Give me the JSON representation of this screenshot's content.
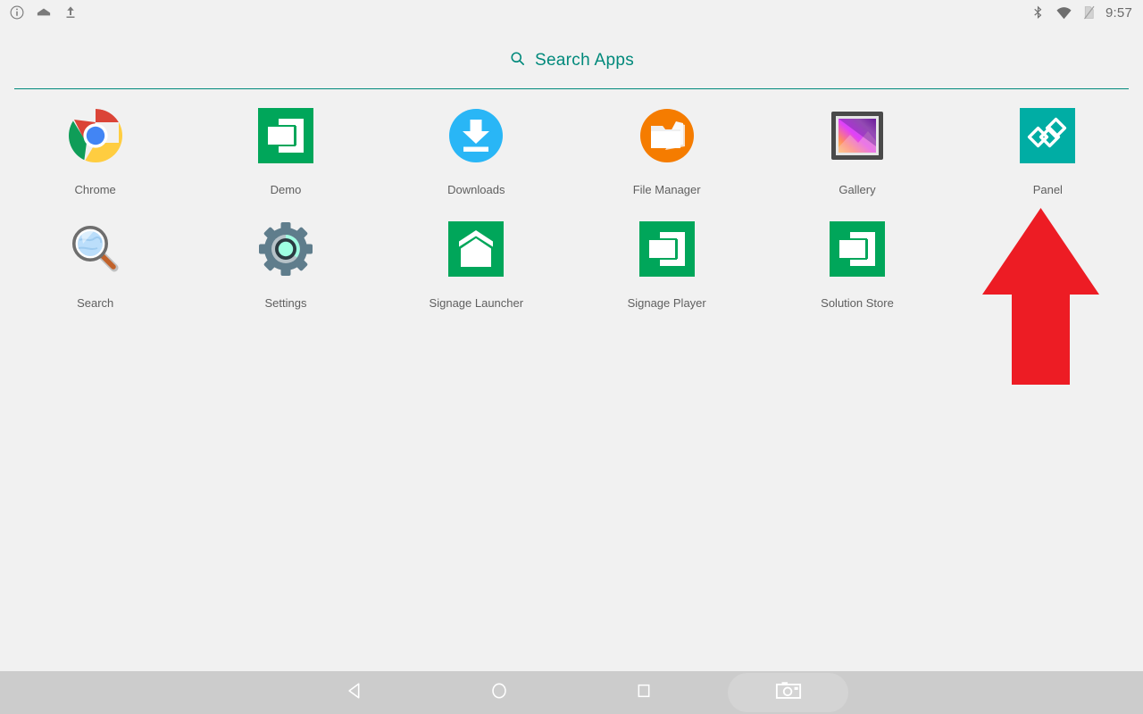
{
  "status_bar": {
    "left_icons": [
      {
        "name": "info-icon",
        "label": "Info"
      },
      {
        "name": "home-notification-icon",
        "label": "Home"
      },
      {
        "name": "upload-icon",
        "label": "Upload"
      }
    ],
    "right_icons": [
      {
        "name": "bluetooth-icon",
        "label": "Bluetooth"
      },
      {
        "name": "wifi-icon",
        "label": "Wi-Fi"
      },
      {
        "name": "sim-off-icon",
        "label": "No SIM"
      }
    ],
    "clock": "9:57"
  },
  "search": {
    "icon": "search-icon",
    "label": "Search Apps"
  },
  "colors": {
    "accent_teal": "#00897b",
    "panel_teal": "#00ada4",
    "signage_green": "#00a65a",
    "demo_green": "#00a65a",
    "downloads_blue": "#29b6f6",
    "file_manager_orange": "#f57c00",
    "arrow_red": "#ed1c24",
    "navbar_gray": "#cccccc",
    "background": "#f1f1f1",
    "label_text": "#5f5f5f"
  },
  "apps": [
    {
      "label": "Chrome",
      "icon": "chrome-icon"
    },
    {
      "label": "Demo",
      "icon": "demo-icon"
    },
    {
      "label": "Downloads",
      "icon": "downloads-icon"
    },
    {
      "label": "File Manager",
      "icon": "file-manager-icon"
    },
    {
      "label": "Gallery",
      "icon": "gallery-icon"
    },
    {
      "label": "Panel",
      "icon": "panel-icon"
    },
    {
      "label": "Search",
      "icon": "search-app-icon"
    },
    {
      "label": "Settings",
      "icon": "settings-icon"
    },
    {
      "label": "Signage Launcher",
      "icon": "signage-launcher-icon"
    },
    {
      "label": "Signage Player",
      "icon": "signage-player-icon"
    },
    {
      "label": "Solution Store",
      "icon": "solution-store-icon"
    }
  ],
  "annotation": {
    "name": "red-pointer-arrow",
    "points_to": "Panel",
    "color": "#ed1c24"
  },
  "nav_bar": {
    "buttons": [
      {
        "name": "back-button",
        "icon": "back-triangle-icon",
        "label": "Back"
      },
      {
        "name": "home-button",
        "icon": "home-circle-icon",
        "label": "Home"
      },
      {
        "name": "recents-button",
        "icon": "recents-square-icon",
        "label": "Recents"
      },
      {
        "name": "screenshot-button",
        "icon": "camera-icon",
        "label": "Screenshot"
      }
    ]
  }
}
